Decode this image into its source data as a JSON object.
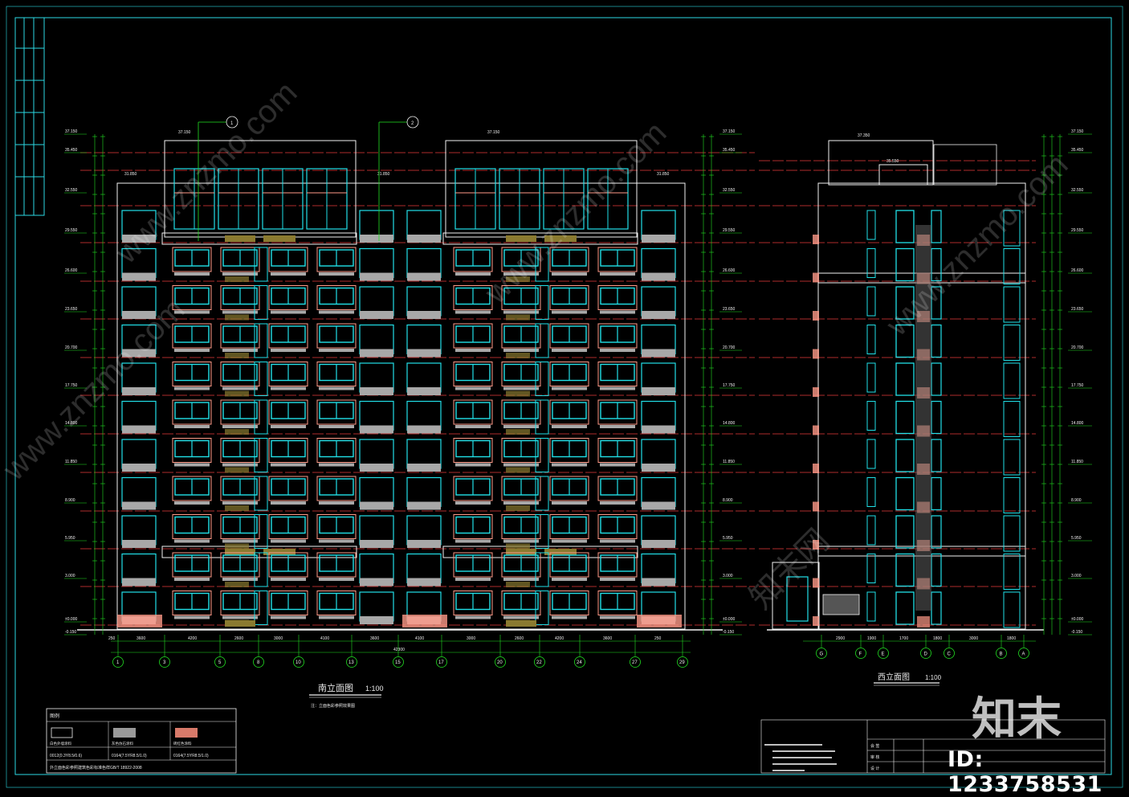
{
  "colors": {
    "background": "#000000",
    "frame": "#2bd9e3",
    "cyan": "#21e0e8",
    "salmon": "#ff9a88",
    "red": "#e83a3a",
    "green": "#22e022",
    "white": "#f2f2f2",
    "gray": "#a8a8a8",
    "olive": "#8a7a30"
  },
  "south": {
    "title": "南立面图",
    "scale": "1:100",
    "note": "注：立面色彩参照效果图",
    "elevations_left": [
      "37.150",
      "35.450",
      "32.550",
      "29.550",
      "26.600",
      "23.650",
      "20.700",
      "17.750",
      "14.800",
      "11.850",
      "8.900",
      "5.950",
      "3.000",
      "±0.000",
      "-0.150"
    ],
    "elevations_right": [
      "37.150",
      "35.450",
      "32.550",
      "29.550",
      "26.600",
      "23.650",
      "20.700",
      "17.750",
      "14.800",
      "11.850",
      "8.900",
      "5.950",
      "3.000",
      "±0.000",
      "-0.150"
    ],
    "roof_labels": [
      "37.150",
      "37.150",
      "31.850",
      "31.850",
      "31.850"
    ],
    "axes": [
      "1",
      "3",
      "5",
      "8",
      "10",
      "13",
      "15",
      "17",
      "20",
      "22",
      "24",
      "27",
      "29"
    ],
    "dims": [
      "250",
      "3600",
      "4200",
      "2600",
      "3000",
      "4100",
      "3600",
      "4100",
      "3000",
      "2600",
      "4200",
      "3600",
      "250"
    ],
    "total": "42300",
    "section_marks": [
      "1",
      "2"
    ]
  },
  "west": {
    "title": "西立面图",
    "scale": "1:100",
    "elevations": [
      "37.150",
      "35.450",
      "32.550",
      "29.550",
      "26.600",
      "23.650",
      "20.700",
      "17.750",
      "14.800",
      "11.850",
      "8.900",
      "5.950",
      "3.000",
      "±0.000",
      "-0.150"
    ],
    "axes": [
      "G",
      "F",
      "E",
      "D",
      "C",
      "B",
      "A"
    ],
    "dims": [
      "2900",
      "1900",
      "1700",
      "1800",
      "3000",
      "1800"
    ],
    "roof_label": "37.350",
    "mid_label": "35.550"
  },
  "legend": {
    "title": "图例",
    "items": [
      "白色外墙涂料",
      "灰色仿石涂料",
      "砖红色涂料"
    ],
    "codes": [
      "0012(0.3Y8.5/0.6)",
      "0164(7.5YR8.5/1.0)",
      "0164(7.5YR8.5/1.0)"
    ],
    "footnote": "外立面色彩参照建筑色彩标准色样GB/T 18922-2008"
  },
  "titleblock": {
    "rows": [
      "会 签",
      "审 核",
      "设 计"
    ]
  },
  "watermark": {
    "brand": "知末",
    "id": "ID: 1233758531",
    "sites": [
      "www.znzmo.com",
      "知末网"
    ]
  }
}
